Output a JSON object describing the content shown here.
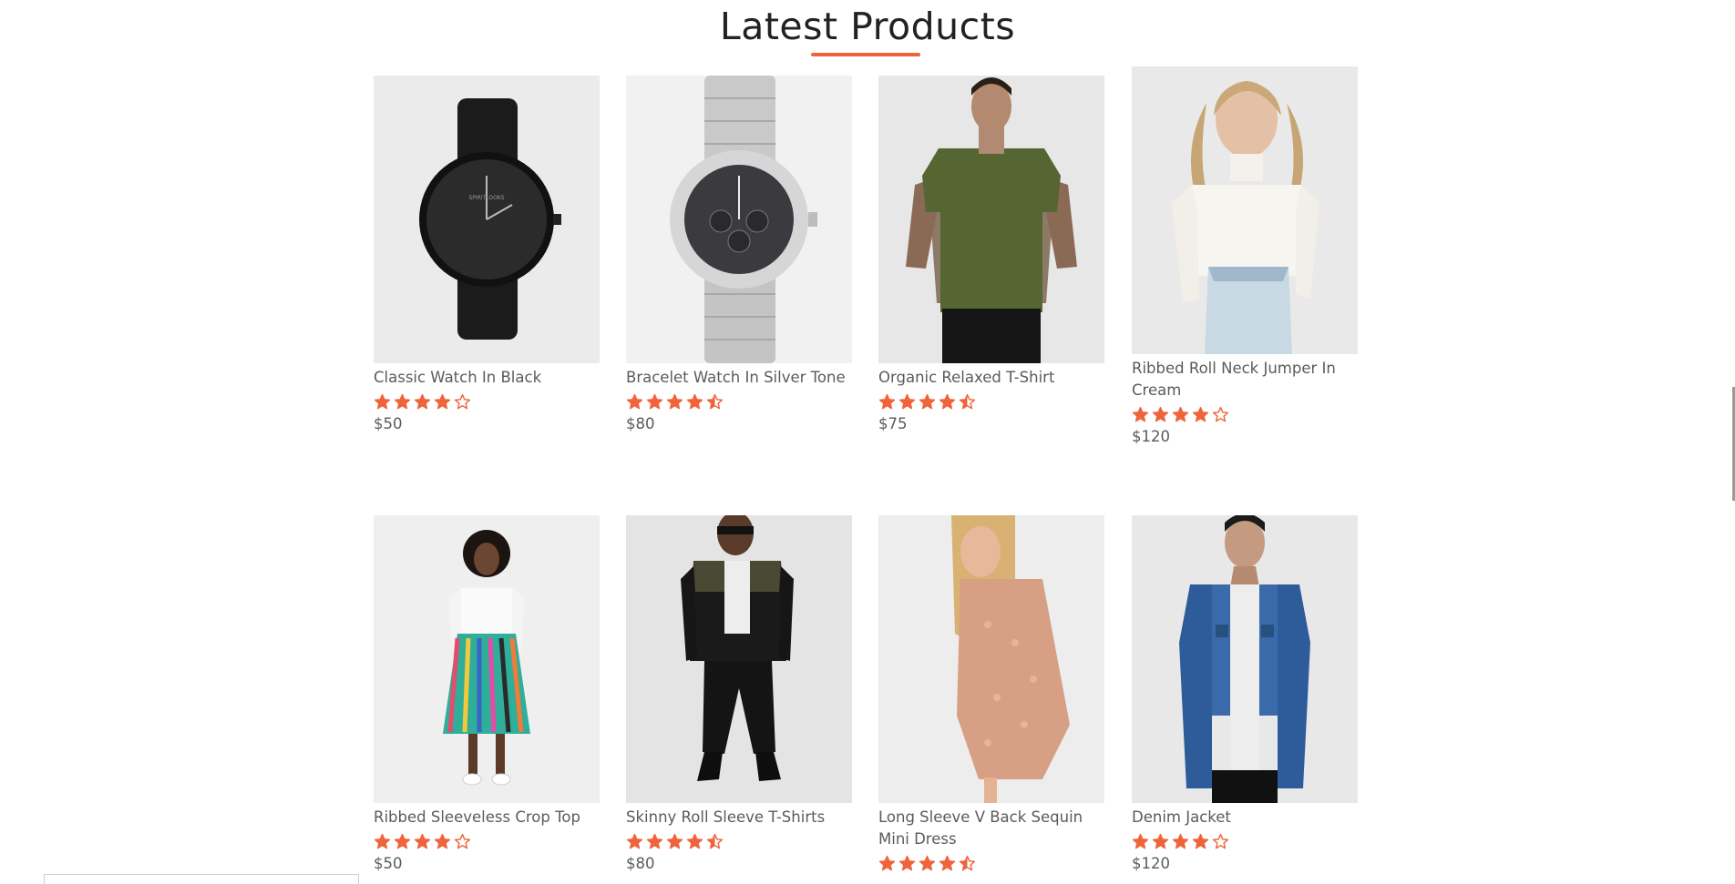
{
  "section": {
    "title": "Latest Products"
  },
  "colors": {
    "accent": "#f0643c",
    "text": "#5b5b5b"
  },
  "products": [
    {
      "name": "Classic Watch In Black",
      "rating": 4,
      "price": "$50",
      "image": "black-watch"
    },
    {
      "name": "Bracelet Watch In Silver Tone",
      "rating": 4.5,
      "price": "$80",
      "image": "silver-watch"
    },
    {
      "name": "Organic Relaxed T-Shirt",
      "rating": 4.5,
      "price": "$75",
      "image": "olive-tshirt-model"
    },
    {
      "name": "Ribbed Roll Neck Jumper In Cream",
      "rating": 4,
      "price": "$120",
      "image": "cream-jumper-model"
    },
    {
      "name": "Ribbed Sleeveless Crop Top",
      "rating": 4,
      "price": "$50",
      "image": "striped-skirt-model"
    },
    {
      "name": "Skinny Roll Sleeve T-Shirts",
      "rating": 4.5,
      "price": "$80",
      "image": "bomber-jacket-model"
    },
    {
      "name": "Long Sleeve V Back Sequin Mini Dress",
      "rating": 4.5,
      "price": "",
      "image": "sequin-dress-model"
    },
    {
      "name": "Denim Jacket",
      "rating": 4,
      "price": "$120",
      "image": "denim-jacket-model"
    }
  ]
}
